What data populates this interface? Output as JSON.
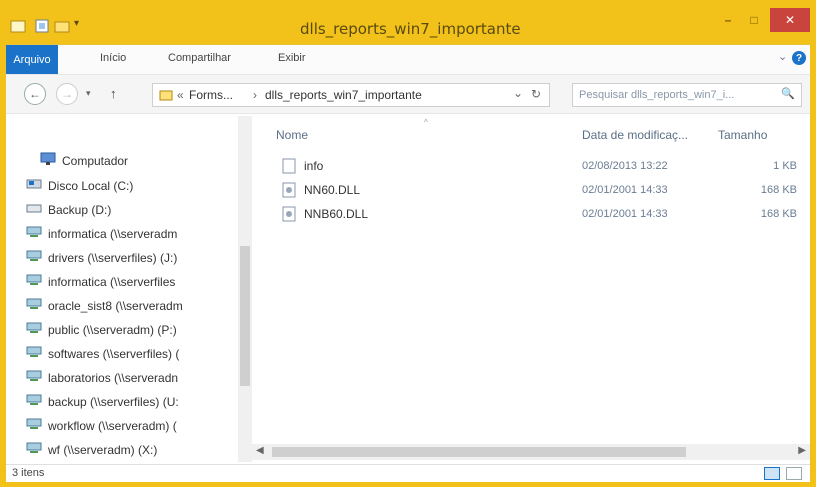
{
  "window": {
    "title": "dlls_reports_win7_importante"
  },
  "title_controls": {
    "minimize": "–",
    "maximize": "□",
    "close": "✕"
  },
  "ribbon": {
    "tabs": [
      {
        "label": "Arquivo",
        "active": true
      },
      {
        "label": "Início"
      },
      {
        "label": "Compartilhar"
      },
      {
        "label": "Exibir"
      }
    ],
    "expand_glyph": "⌄",
    "help_glyph": "?"
  },
  "addressbar": {
    "back_glyph": "←",
    "forward_glyph": "→",
    "up_glyph": "↑",
    "path": {
      "prefix": "«",
      "crumb_1": "Forms...",
      "sep": "›",
      "crumb_2": "dlls_reports_win7_importante"
    },
    "dropdown_glyph": "⌄",
    "refresh_glyph": "↻",
    "search_placeholder": "Pesquisar dlls_reports_win7_i...",
    "search_glyph": "🔍"
  },
  "nav_pane": {
    "root": "Computador",
    "items": [
      {
        "label": "Disco Local (C:)",
        "icon": "windows-drive-icon"
      },
      {
        "label": "Backup (D:)",
        "icon": "drive-icon"
      },
      {
        "label": "informatica (\\\\serveradm",
        "icon": "network-drive-icon"
      },
      {
        "label": "drivers (\\\\serverfiles) (J:)",
        "icon": "network-drive-icon"
      },
      {
        "label": "informatica (\\\\serverfiles",
        "icon": "network-drive-icon"
      },
      {
        "label": "oracle_sist8 (\\\\serveradm",
        "icon": "network-drive-icon"
      },
      {
        "label": "public (\\\\serveradm) (P:)",
        "icon": "network-drive-icon"
      },
      {
        "label": "softwares (\\\\serverfiles) (",
        "icon": "network-drive-icon"
      },
      {
        "label": "laboratorios (\\\\serveradn",
        "icon": "network-drive-icon"
      },
      {
        "label": "backup (\\\\serverfiles) (U:",
        "icon": "network-drive-icon"
      },
      {
        "label": "workflow (\\\\serveradm) (",
        "icon": "network-drive-icon"
      },
      {
        "label": "wf (\\\\serveradm) (X:)",
        "icon": "network-drive-icon"
      }
    ]
  },
  "file_list": {
    "columns": {
      "name": "Nome",
      "date": "Data de modificaç...",
      "size": "Tamanho"
    },
    "rows": [
      {
        "name": "info",
        "date": "02/08/2013 13:22",
        "size": "1 KB",
        "icon": "text-file-icon"
      },
      {
        "name": "NN60.DLL",
        "date": "02/01/2001 14:33",
        "size": "168 KB",
        "icon": "dll-file-icon"
      },
      {
        "name": "NNB60.DLL",
        "date": "02/01/2001 14:33",
        "size": "168 KB",
        "icon": "dll-file-icon"
      }
    ]
  },
  "status": {
    "count": "3 itens"
  },
  "colors": {
    "accent": "#f2c21a",
    "file_tab": "#1a73c8",
    "close_button": "#c9443c"
  }
}
